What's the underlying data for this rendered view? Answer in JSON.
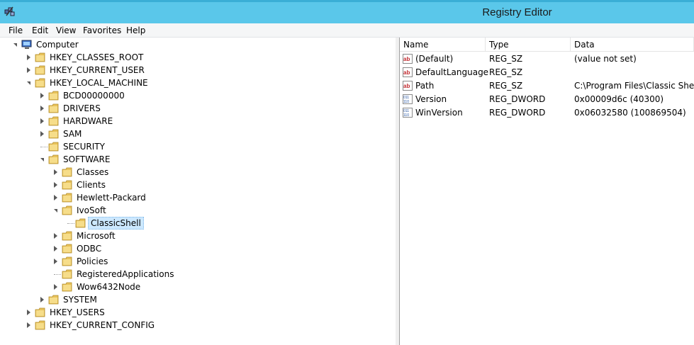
{
  "window": {
    "title": "Registry Editor"
  },
  "menu": [
    "File",
    "Edit",
    "View",
    "Favorites",
    "Help"
  ],
  "tree": [
    {
      "label": "Computer",
      "level": 0,
      "exp": "open",
      "icon": "computer-icon"
    },
    {
      "label": "HKEY_CLASSES_ROOT",
      "level": 1,
      "exp": "closed"
    },
    {
      "label": "HKEY_CURRENT_USER",
      "level": 1,
      "exp": "closed"
    },
    {
      "label": "HKEY_LOCAL_MACHINE",
      "level": 1,
      "exp": "open"
    },
    {
      "label": "BCD00000000",
      "level": 2,
      "exp": "closed"
    },
    {
      "label": "DRIVERS",
      "level": 2,
      "exp": "closed"
    },
    {
      "label": "HARDWARE",
      "level": 2,
      "exp": "closed"
    },
    {
      "label": "SAM",
      "level": 2,
      "exp": "closed"
    },
    {
      "label": "SECURITY",
      "level": 2,
      "exp": "none"
    },
    {
      "label": "SOFTWARE",
      "level": 2,
      "exp": "open"
    },
    {
      "label": "Classes",
      "level": 3,
      "exp": "closed"
    },
    {
      "label": "Clients",
      "level": 3,
      "exp": "closed"
    },
    {
      "label": "Hewlett-Packard",
      "level": 3,
      "exp": "closed"
    },
    {
      "label": "IvoSoft",
      "level": 3,
      "exp": "open"
    },
    {
      "label": "ClassicShell",
      "level": 4,
      "exp": "none",
      "selected": true
    },
    {
      "label": "Microsoft",
      "level": 3,
      "exp": "closed"
    },
    {
      "label": "ODBC",
      "level": 3,
      "exp": "closed"
    },
    {
      "label": "Policies",
      "level": 3,
      "exp": "closed"
    },
    {
      "label": "RegisteredApplications",
      "level": 3,
      "exp": "none"
    },
    {
      "label": "Wow6432Node",
      "level": 3,
      "exp": "closed"
    },
    {
      "label": "SYSTEM",
      "level": 2,
      "exp": "closed"
    },
    {
      "label": "HKEY_USERS",
      "level": 1,
      "exp": "closed"
    },
    {
      "label": "HKEY_CURRENT_CONFIG",
      "level": 1,
      "exp": "closed"
    }
  ],
  "list": {
    "headers": {
      "name": "Name",
      "type": "Type",
      "data": "Data"
    },
    "rows": [
      {
        "name": "(Default)",
        "type": "REG_SZ",
        "data": "(value not set)",
        "icon": "string-value-icon"
      },
      {
        "name": "DefaultLanguage",
        "type": "REG_SZ",
        "data": "",
        "icon": "string-value-icon"
      },
      {
        "name": "Path",
        "type": "REG_SZ",
        "data": "C:\\Program Files\\Classic Shell\\",
        "icon": "string-value-icon"
      },
      {
        "name": "Version",
        "type": "REG_DWORD",
        "data": "0x00009d6c (40300)",
        "icon": "binary-value-icon"
      },
      {
        "name": "WinVersion",
        "type": "REG_DWORD",
        "data": "0x06032580 (100869504)",
        "icon": "binary-value-icon"
      }
    ]
  },
  "colors": {
    "titlebar": "#5ac7ea",
    "selection": "#cce8ff",
    "folder": "#e8c25a"
  }
}
